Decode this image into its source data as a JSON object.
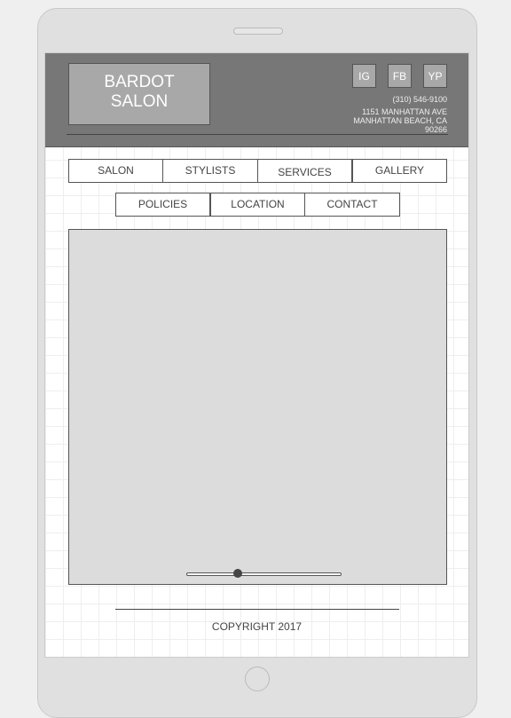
{
  "logo": {
    "line1": "BARDOT",
    "line2": "SALON"
  },
  "social": [
    {
      "label": "IG"
    },
    {
      "label": "FB"
    },
    {
      "label": "YP"
    }
  ],
  "contact": {
    "phone": "(310) 546-9100",
    "address1": "1151 MANHATTAN AVE",
    "address2": "MANHATTAN BEACH, CA",
    "zip": "90266"
  },
  "nav_row1": [
    {
      "label": "SALON"
    },
    {
      "label": "STYLISTS"
    },
    {
      "label": "SERVICES"
    },
    {
      "label": "GALLERY"
    }
  ],
  "nav_row2": [
    {
      "label": "POLICIES"
    },
    {
      "label": "LOCATION"
    },
    {
      "label": "CONTACT"
    }
  ],
  "slider": {
    "value": 0.33
  },
  "footer": {
    "copyright": "COPYRIGHT 2017"
  }
}
